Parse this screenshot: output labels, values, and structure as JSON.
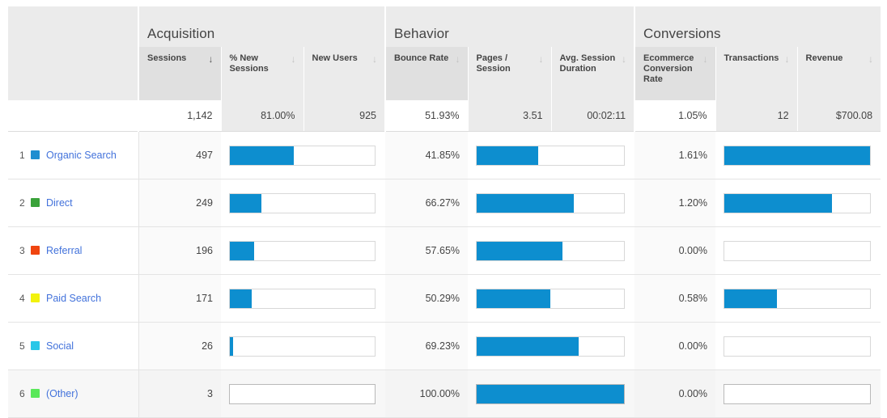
{
  "table": {
    "groups": [
      {
        "name": "blank",
        "label": "",
        "span": 1
      },
      {
        "name": "acquisition",
        "label": "Acquisition",
        "span": 3
      },
      {
        "name": "behavior",
        "label": "Behavior",
        "span": 3
      },
      {
        "name": "conversions",
        "label": "Conversions",
        "span": 3
      }
    ],
    "columns": [
      {
        "label": "",
        "sort": "none"
      },
      {
        "label": "Sessions",
        "sort": "desc-active"
      },
      {
        "label": "% New Sessions",
        "sort": "desc"
      },
      {
        "label": "New Users",
        "sort": "desc"
      },
      {
        "label": "Bounce Rate",
        "sort": "desc"
      },
      {
        "label": "Pages / Session",
        "sort": "desc"
      },
      {
        "label": "Avg. Session Duration",
        "sort": "desc"
      },
      {
        "label": "Ecommerce Conversion Rate",
        "sort": "desc"
      },
      {
        "label": "Transactions",
        "sort": "desc"
      },
      {
        "label": "Revenue",
        "sort": "desc"
      }
    ],
    "summary": {
      "label": "",
      "sessions": "1,142",
      "pct_new_sessions": "81.00%",
      "new_users": "925",
      "bounce_rate": "51.93%",
      "pages_per_session": "3.51",
      "avg_session_duration": "00:02:11",
      "ecommerce_conversion_rate": "1.05%",
      "transactions": "12",
      "revenue": "$700.08"
    },
    "rows": [
      {
        "rank": "1",
        "channel": "Organic Search",
        "swatch_color": "#1f8ed0",
        "sessions": "497",
        "sessions_bar_pct": 44,
        "bounce_rate": "41.85%",
        "bounce_bar_pct": 42,
        "ecommerce_conversion_rate": "1.61%",
        "ecommerce_bar_pct": 100,
        "highlight": false,
        "alt": false
      },
      {
        "rank": "2",
        "channel": "Direct",
        "swatch_color": "#3aa23a",
        "sessions": "249",
        "sessions_bar_pct": 22,
        "bounce_rate": "66.27%",
        "bounce_bar_pct": 66,
        "ecommerce_conversion_rate": "1.20%",
        "ecommerce_bar_pct": 74,
        "highlight": false,
        "alt": false
      },
      {
        "rank": "3",
        "channel": "Referral",
        "swatch_color": "#f04510",
        "sessions": "196",
        "sessions_bar_pct": 17,
        "bounce_rate": "57.65%",
        "bounce_bar_pct": 58,
        "ecommerce_conversion_rate": "0.00%",
        "ecommerce_bar_pct": 0,
        "highlight": false,
        "alt": false
      },
      {
        "rank": "4",
        "channel": "Paid Search",
        "swatch_color": "#f2f20d",
        "sessions": "171",
        "sessions_bar_pct": 15,
        "bounce_rate": "50.29%",
        "bounce_bar_pct": 50,
        "ecommerce_conversion_rate": "0.58%",
        "ecommerce_bar_pct": 36,
        "highlight": false,
        "alt": false
      },
      {
        "rank": "5",
        "channel": "Social",
        "swatch_color": "#2ac7e8",
        "sessions": "26",
        "sessions_bar_pct": 2,
        "bounce_rate": "69.23%",
        "bounce_bar_pct": 69,
        "ecommerce_conversion_rate": "0.00%",
        "ecommerce_bar_pct": 0,
        "highlight": false,
        "alt": false
      },
      {
        "rank": "6",
        "channel": "(Other)",
        "swatch_color": "#5ae85a",
        "sessions": "3",
        "sessions_bar_pct": 0,
        "bounce_rate": "100.00%",
        "bounce_bar_pct": 100,
        "ecommerce_conversion_rate": "0.00%",
        "ecommerce_bar_pct": 0,
        "highlight": true,
        "alt": true
      }
    ]
  },
  "icons": {
    "sort_desc": "↓"
  },
  "colors": {
    "bar_fill": "#0d8ecf",
    "link": "#4272db",
    "header_bg": "#ebebeb",
    "highlight_bg": "#fcfbcf"
  }
}
